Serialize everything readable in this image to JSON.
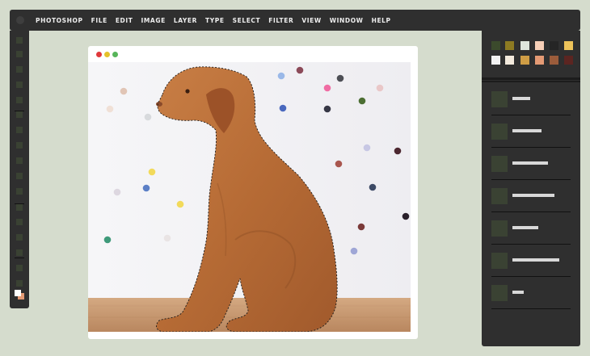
{
  "menubar": {
    "items": [
      "PHOTOSHOP",
      "FILE",
      "EDIT",
      "IMAGE",
      "LAYER",
      "TYPE",
      "SELECT",
      "FILTER",
      "VIEW",
      "WINDOW",
      "HELP"
    ]
  },
  "toolbar": {
    "tool_count": 20,
    "foreground_color": "#ffffff",
    "background_color": "#e49a74"
  },
  "swatches": {
    "row1": [
      "#3b4a2c",
      "#8d7a22",
      "#dfe5dd",
      "#f7cfb7",
      "#252525",
      "#eec35a"
    ],
    "row2": [
      "#f2f2f2",
      "#f3eadd",
      "#cf9d45",
      "#e49a74",
      "#9b5c3b",
      "#5c2521"
    ]
  },
  "layers": {
    "count": 7
  },
  "document": {
    "window_buttons": [
      "close",
      "minimize",
      "maximize"
    ],
    "window_button_colors": [
      "#e0383a",
      "#e5c22a",
      "#57b55a"
    ],
    "image_subject": "dog",
    "confetti_colors": [
      "#e1c5b5",
      "#f0e0d6",
      "#d8dadd",
      "#f2da5b",
      "#5c7fc6",
      "#ddd7e0",
      "#3f9a7a",
      "#f2da5b",
      "#e9e4e4",
      "#8c4a59",
      "#f06ca3",
      "#4d4f55",
      "#4c6e33",
      "#9ab8e8",
      "#4a68be",
      "#363745",
      "#c7c7e4",
      "#4c2830",
      "#a9564e",
      "#3d4a66",
      "#7b3a39",
      "#9fa6d6",
      "#291f2a",
      "#e9c7c8"
    ]
  }
}
